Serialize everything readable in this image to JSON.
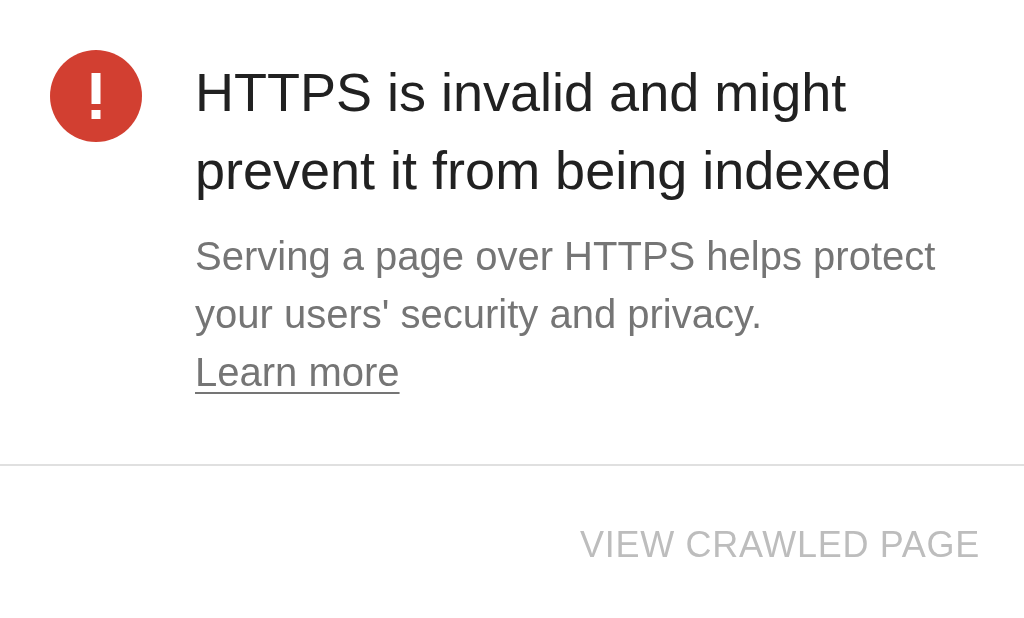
{
  "alert": {
    "kind": "error",
    "title": "HTTPS is invalid and might prevent it from being indexed",
    "description": "Serving a page over HTTPS helps protect your users' security and privacy.",
    "link": "Learn more"
  },
  "actions": [
    {
      "label": "VIEW CRAWLED PAGE",
      "disabled": true
    }
  ]
}
